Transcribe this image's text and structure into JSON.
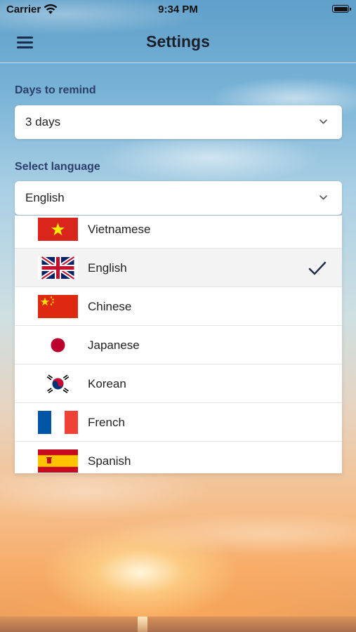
{
  "status_bar": {
    "carrier": "Carrier",
    "time": "9:34 PM",
    "wifi_icon": "wifi-icon",
    "battery_icon": "battery-icon"
  },
  "nav": {
    "title": "Settings",
    "menu_icon": "hamburger-menu-icon"
  },
  "remind": {
    "label": "Days to remind",
    "value": "3 days"
  },
  "language": {
    "label": "Select language",
    "value": "English",
    "options": [
      {
        "label": "Vietnamese",
        "flag": "vietnam-flag-icon",
        "selected": false
      },
      {
        "label": "English",
        "flag": "uk-flag-icon",
        "selected": true
      },
      {
        "label": "Chinese",
        "flag": "china-flag-icon",
        "selected": false
      },
      {
        "label": "Japanese",
        "flag": "japan-flag-icon",
        "selected": false
      },
      {
        "label": "Korean",
        "flag": "korea-flag-icon",
        "selected": false
      },
      {
        "label": "French",
        "flag": "france-flag-icon",
        "selected": false
      },
      {
        "label": "Spanish",
        "flag": "spain-flag-icon",
        "selected": false
      }
    ]
  },
  "colors": {
    "label": "#2c3f6b",
    "nav_title": "#1b1f2a",
    "check": "#1d2b4a"
  }
}
